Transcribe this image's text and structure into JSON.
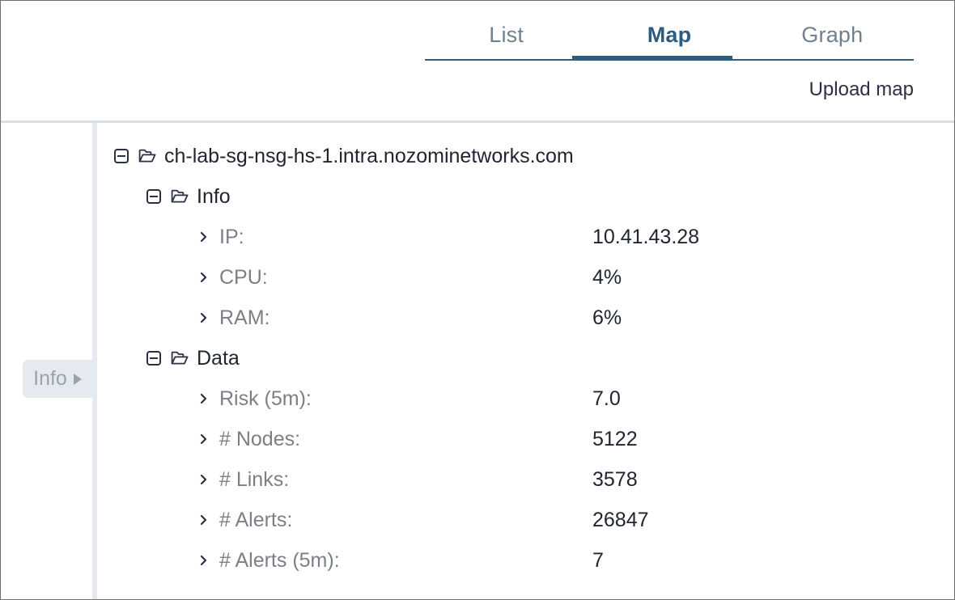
{
  "header": {
    "tabs": [
      {
        "label": "List",
        "active": false
      },
      {
        "label": "Map",
        "active": true
      },
      {
        "label": "Graph",
        "active": false
      }
    ],
    "upload_map_label": "Upload map",
    "accent_color": "#2c5d80",
    "inactive_tab_color": "#70808f"
  },
  "side_tab": {
    "label": "Info",
    "caret": "caret-right-icon",
    "background": "#e4eaf0",
    "text_color": "#9aa3ab"
  },
  "tree": {
    "root": {
      "label": "ch-lab-sg-nsg-hs-1.intra.nozominetworks.com",
      "icon": "open-folder-icon",
      "toggle": "collapse-minus-icon",
      "expanded": true
    },
    "groups": [
      {
        "label": "Info",
        "icon": "open-folder-icon",
        "toggle": "collapse-minus-icon",
        "expanded": true,
        "items": [
          {
            "label": "IP:",
            "value": "10.41.43.28"
          },
          {
            "label": "CPU:",
            "value": "4%"
          },
          {
            "label": "RAM:",
            "value": "6%"
          }
        ]
      },
      {
        "label": "Data",
        "icon": "open-folder-icon",
        "toggle": "collapse-minus-icon",
        "expanded": true,
        "items": [
          {
            "label": "Risk (5m):",
            "value": "7.0"
          },
          {
            "label": "# Nodes:",
            "value": "5122"
          },
          {
            "label": "# Links:",
            "value": "3578"
          },
          {
            "label": "# Alerts:",
            "value": "26847"
          },
          {
            "label": "# Alerts (5m):",
            "value": "7"
          }
        ]
      }
    ]
  }
}
